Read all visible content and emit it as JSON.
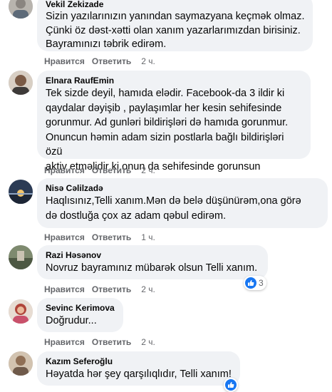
{
  "colors": {
    "bubble": "#f0f2f5",
    "meta": "#65676b",
    "like_blue": "#1877f2"
  },
  "comments": [
    {
      "author": "Vekil Zekizade",
      "text": "Sizin yazılarınızın yanından saymazyana keçmək olmaz.\nÇünki öz dəst-xətti olan xanım yazarlarımızdan birisiniz.\nBayramınızı təbrik edirəm.",
      "like_label": "Нравится",
      "reply_label": "Ответить",
      "time": "2 ч.",
      "avatar_icon": "profile-photo"
    },
    {
      "author": "Elnara RaufEmin",
      "text": "Tek sizde deyil, hamıda elədir. Facebook-da 3 ildir ki\nqaydalar dəyişib , paylaşımlar her kesin sehifesinde\ngorunmur. Ad gunləri bildirişləri də hamıda gorunmur.\nOnuncun həmin adam sizin postlarla bağlı bildirişləri özü\naktiv etməlidir ki onun da sehifesinde gorunsun",
      "like_label": "Нравится",
      "reply_label": "Ответить",
      "time": "2 ч.",
      "avatar_icon": "profile-photo"
    },
    {
      "author": "Nisə Cəlilzadə",
      "text": "Haqlısınız,Telli xanım.Mən də belə düşünürəm,ona görə\ndə dostluğa çox az adam qəbul edirəm.",
      "like_label": "Нравится",
      "reply_label": "Ответить",
      "time": "1 ч.",
      "avatar_icon": "profile-photo"
    },
    {
      "author": "Razi Həsənov",
      "text": "Novruz bayramınız mübarək olsun Telli xanım.",
      "like_label": "Нравится",
      "reply_label": "Ответить",
      "time": "2 ч.",
      "reaction_count": "3",
      "avatar_icon": "profile-photo"
    },
    {
      "author": "Sevinc Kerimova",
      "text": "Doğrudur...",
      "like_label": "Нравится",
      "reply_label": "Ответить",
      "time": "2 ч.",
      "avatar_icon": "profile-photo"
    },
    {
      "author": "Kazım Seferoğlu",
      "text": "Həyatda hər şey qarşılıqlıdır, Telli xanım!",
      "avatar_icon": "profile-photo"
    }
  ]
}
